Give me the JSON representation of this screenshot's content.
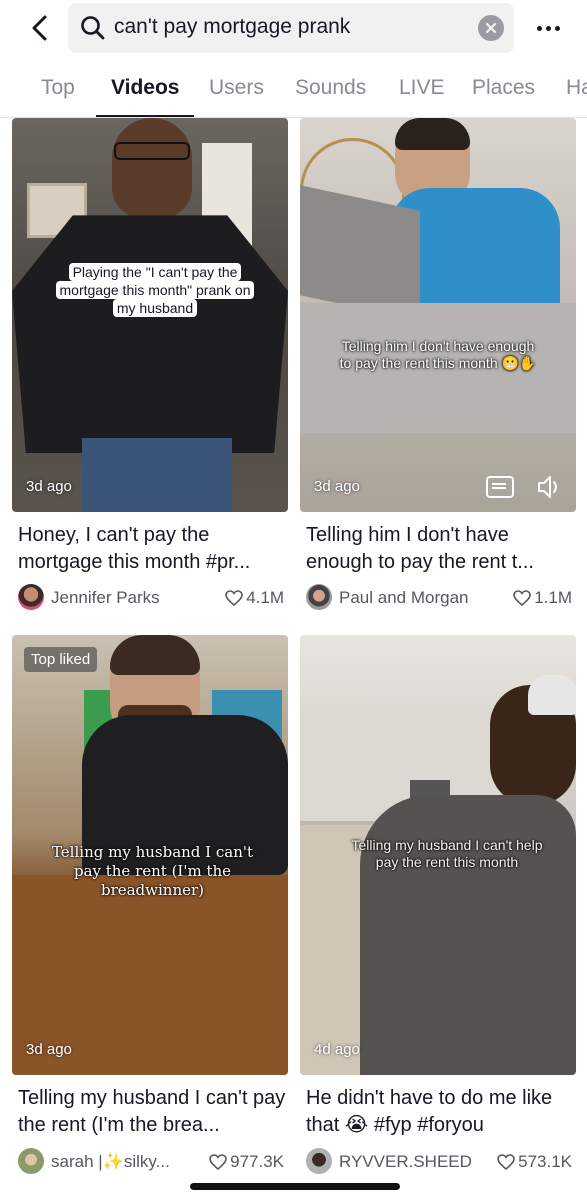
{
  "search": {
    "query": "can't pay mortgage prank",
    "back_icon": "chevron-left-icon",
    "search_icon": "magnifier-icon",
    "clear_icon": "clear-circle-icon",
    "more_icon": "ellipsis-icon"
  },
  "tabs": [
    {
      "label": "Top",
      "active": false
    },
    {
      "label": "Videos",
      "active": true
    },
    {
      "label": "Users",
      "active": false
    },
    {
      "label": "Sounds",
      "active": false
    },
    {
      "label": "LIVE",
      "active": false
    },
    {
      "label": "Places",
      "active": false
    },
    {
      "label": "Ha",
      "active": false
    }
  ],
  "videos": [
    {
      "overlay": "Playing the \"I can't pay the mortgage this month\" prank on my husband",
      "ago": "3d ago",
      "title": "Honey, I can't pay the mortgage this month #pr...",
      "author": "Jennifer Parks",
      "likes": "4.1M"
    },
    {
      "overlay": "Telling him I don't have enough to pay the rent this month 😬✋",
      "ago": "3d ago",
      "title": "Telling him I don't have enough to pay the rent t...",
      "author": "Paul and Morgan",
      "likes": "1.1M"
    },
    {
      "badge": "Top liked",
      "overlay": "Telling my husband I can't pay the rent (I'm the breadwinner)",
      "ago": "3d ago",
      "title": "Telling my husband I can't pay the rent (I'm the brea...",
      "author": "sarah |✨silky...",
      "likes": "977.3K"
    },
    {
      "overlay": "Telling my husband I can't help pay the rent this month",
      "ago": "4d ago",
      "title": "He didn't have to do me like that 😭 #fyp #foryou",
      "author": "RYVVER.SHEED",
      "likes": "573.1K"
    }
  ],
  "colors": {
    "text_primary": "#161823",
    "text_secondary": "#57585e",
    "tab_inactive": "#8a8b91",
    "search_bg": "#f1f1f2"
  }
}
